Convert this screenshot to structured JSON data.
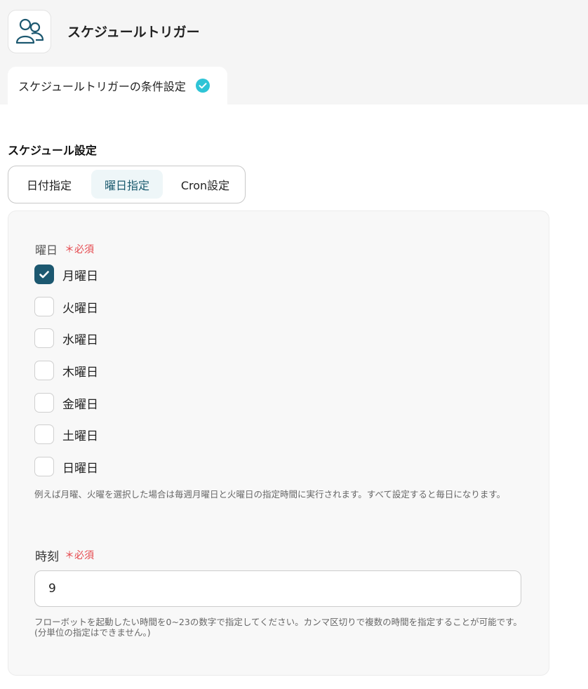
{
  "header": {
    "title": "スケジュールトリガー",
    "app_icon": "users-icon"
  },
  "tabs": [
    {
      "label": "スケジュールトリガーの条件設定",
      "status_icon": "check-circle-icon",
      "active": true
    }
  ],
  "schedule": {
    "section_title": "スケジュール設定",
    "mode_options": [
      "日付指定",
      "曜日指定",
      "Cron設定"
    ],
    "selected_mode": "曜日指定"
  },
  "weekday_field": {
    "label": "曜日",
    "required": "＊必須",
    "options": [
      {
        "label": "月曜日",
        "checked": true
      },
      {
        "label": "火曜日",
        "checked": false
      },
      {
        "label": "水曜日",
        "checked": false
      },
      {
        "label": "木曜日",
        "checked": false
      },
      {
        "label": "金曜日",
        "checked": false
      },
      {
        "label": "土曜日",
        "checked": false
      },
      {
        "label": "日曜日",
        "checked": false
      }
    ],
    "help_text": "例えば月曜、火曜を選択した場合は毎週月曜日と火曜日の指定時間に実行されます。すべて設定すると毎日になります。"
  },
  "time_field": {
    "label": "時刻",
    "required": "＊必須",
    "value": "9",
    "help_text": "フローボットを起動したい時間を0~23の数字で指定してください。カンマ区切りで複数の時間を指定することが可能です。(分単位の指定はできません。)"
  },
  "colors": {
    "accent": "#1c5870",
    "check_badge": "#2ec4d6",
    "required": "#e5484d"
  }
}
